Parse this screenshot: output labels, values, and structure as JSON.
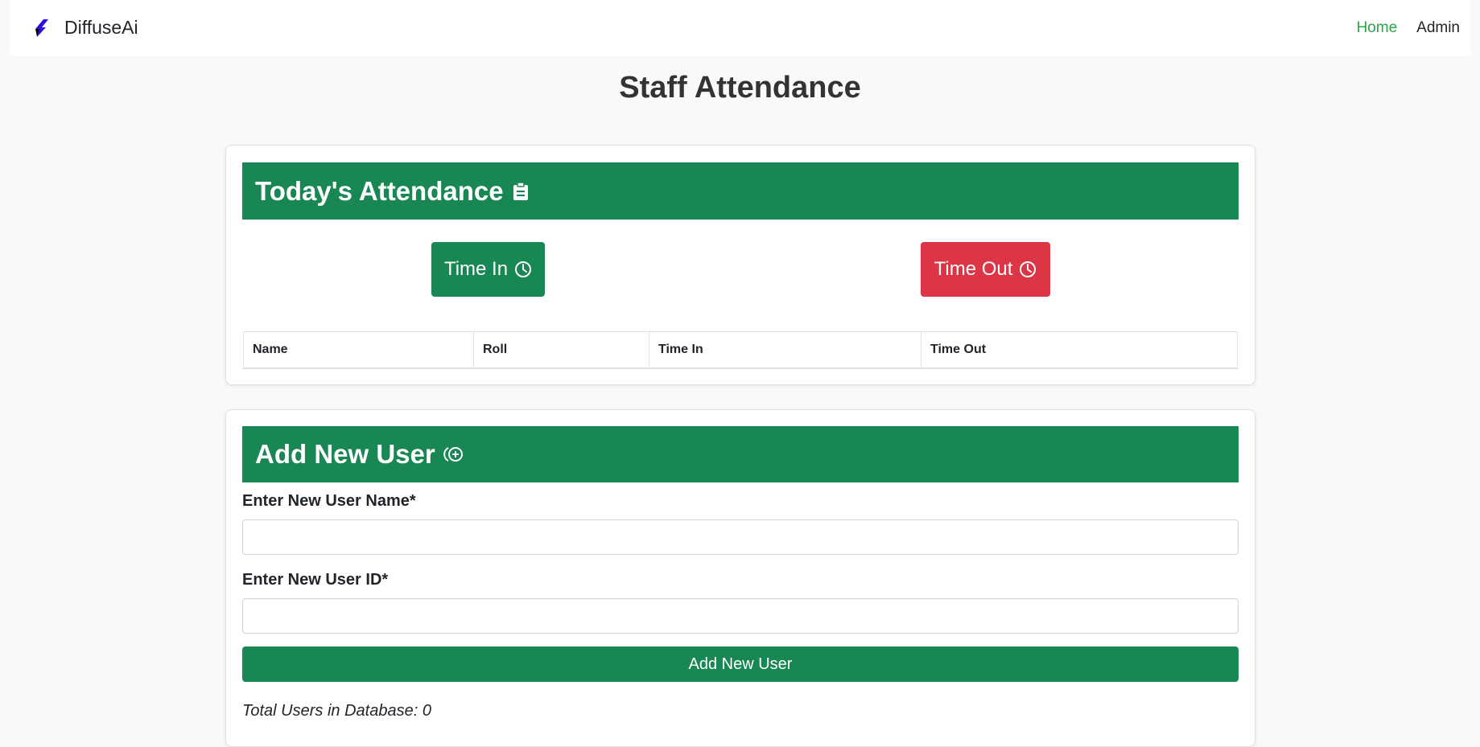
{
  "navbar": {
    "brand": "DiffuseAi",
    "links": [
      {
        "label": "Home"
      },
      {
        "label": "Admin"
      }
    ]
  },
  "page_title": "Staff Attendance",
  "attendance": {
    "header": "Today's Attendance",
    "time_in_label": "Time In",
    "time_out_label": "Time Out",
    "columns": [
      "Name",
      "Roll",
      "Time In",
      "Time Out"
    ]
  },
  "add_user": {
    "header": "Add New User",
    "name_label": "Enter New User Name*",
    "name_value": "",
    "id_label": "Enter New User ID*",
    "id_value": "",
    "submit_label": "Add New User",
    "total_text": "Total Users in Database: 0"
  },
  "colors": {
    "primary_green": "#198754",
    "danger_red": "#dc3545",
    "nav_active": "#28a745"
  }
}
